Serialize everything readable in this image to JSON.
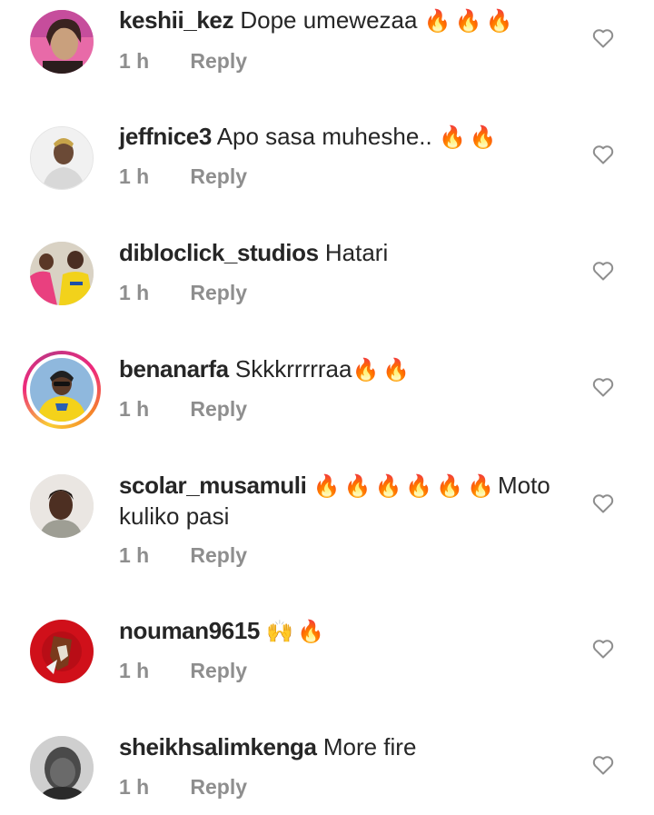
{
  "reply_label": "Reply",
  "colors": {
    "text": "#262626",
    "secondary": "#8e8e8e",
    "fire": "#f4511e"
  },
  "comments": [
    {
      "username": "keshii_kez",
      "text": "Dope umewezaa",
      "emoji": "🔥🔥🔥",
      "time": "1 h"
    },
    {
      "username": "jeffnice3",
      "text": "Apo sasa muheshe..",
      "emoji": "🔥🔥",
      "time": "1 h"
    },
    {
      "username": "dibloclick_studios",
      "text": "Hatari",
      "emoji": "",
      "time": "1 h"
    },
    {
      "username": "benanarfa",
      "text": "Skkkrrrrraa",
      "emoji": "🔥🔥",
      "time": "1 h"
    },
    {
      "username": "scolar_musamuli",
      "text": "Moto kuliko pasi",
      "emoji": "🔥🔥🔥🔥🔥🔥",
      "time": "1 h"
    },
    {
      "username": "nouman9615",
      "text": "",
      "emoji": "🙌🔥",
      "time": "1 h"
    },
    {
      "username": "sheikhsalimkenga",
      "text": "More fire",
      "emoji": "",
      "time": "1 h"
    }
  ]
}
